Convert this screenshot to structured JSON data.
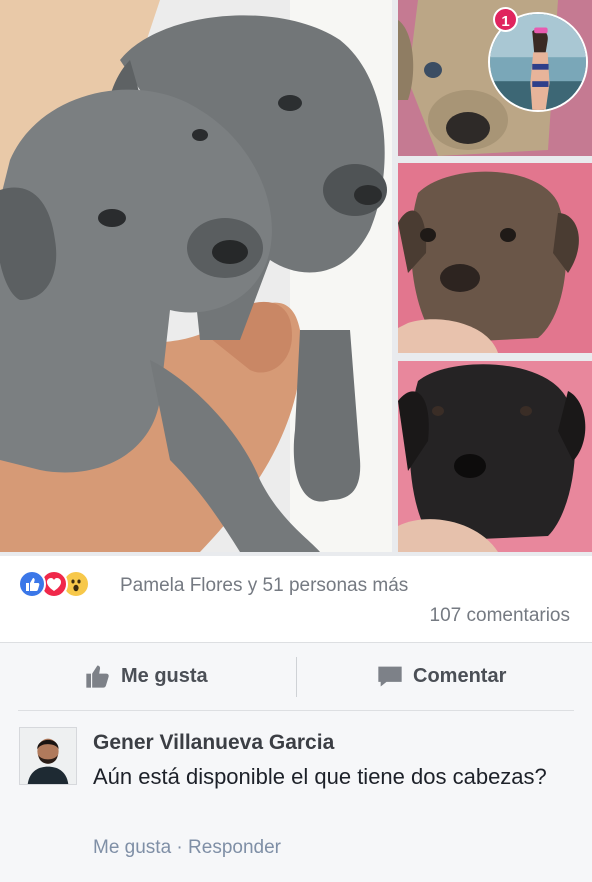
{
  "post": {
    "photos": [
      {
        "name": "main-photo",
        "subject": "two grey puppies held in hands"
      },
      {
        "name": "thumb-1",
        "subject": "fawn puppy"
      },
      {
        "name": "thumb-2",
        "subject": "brindle puppy"
      },
      {
        "name": "thumb-3",
        "subject": "black puppy"
      }
    ]
  },
  "chat_head": {
    "badge_count": "1"
  },
  "reactions": {
    "icons": [
      "like-icon",
      "love-icon",
      "wow-icon"
    ],
    "summary": "Pamela Flores y 51 personas más",
    "comments_count": "107 comentarios"
  },
  "actions": {
    "like_label": "Me gusta",
    "comment_label": "Comentar"
  },
  "comment": {
    "author": "Gener Villanueva Garcia",
    "text": "Aún está disponible el que tiene dos cabezas?",
    "like_label": "Me gusta",
    "separator": " · ",
    "reply_label": "Responder"
  },
  "colors": {
    "like_blue": "#3b77e8",
    "love_red": "#f0284a",
    "wow_yellow": "#f7c84a",
    "badge_red": "#e0245e",
    "secondary_text": "#757a82",
    "link_text": "#7f8fa6"
  }
}
